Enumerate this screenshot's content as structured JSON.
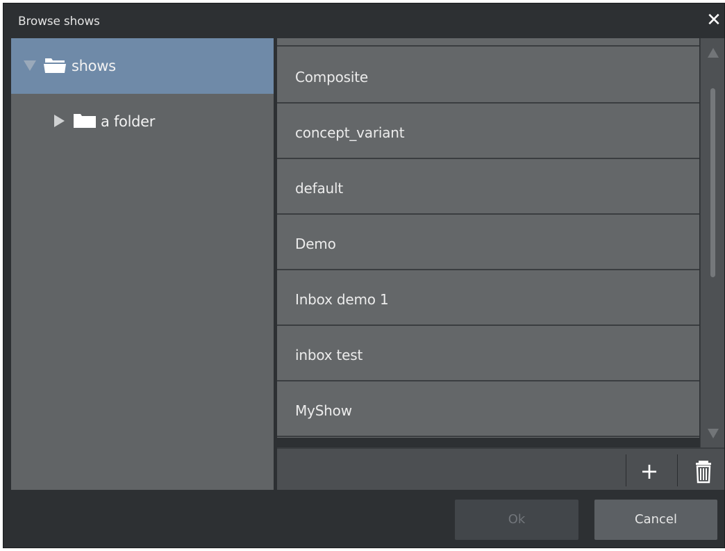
{
  "window": {
    "title": "Browse shows",
    "close_icon": "close-icon"
  },
  "tree": {
    "items": [
      {
        "label": "shows",
        "expanded": true,
        "selected": true,
        "icon": "folder-open-icon"
      },
      {
        "label": "a folder",
        "expanded": false,
        "selected": false,
        "icon": "folder-icon"
      }
    ]
  },
  "list": {
    "items": [
      {
        "label": "Composite"
      },
      {
        "label": "concept_variant"
      },
      {
        "label": "default"
      },
      {
        "label": "Demo"
      },
      {
        "label": "Inbox demo 1"
      },
      {
        "label": "inbox test"
      },
      {
        "label": "MyShow"
      }
    ]
  },
  "toolbar": {
    "add_label": "+",
    "delete_icon": "trash-icon"
  },
  "buttons": {
    "ok": "Ok",
    "cancel": "Cancel",
    "ok_enabled": false
  },
  "colors": {
    "background": "#2d3033",
    "selection": "#6f8aa8",
    "panel": "#616466",
    "list": "#646769"
  }
}
